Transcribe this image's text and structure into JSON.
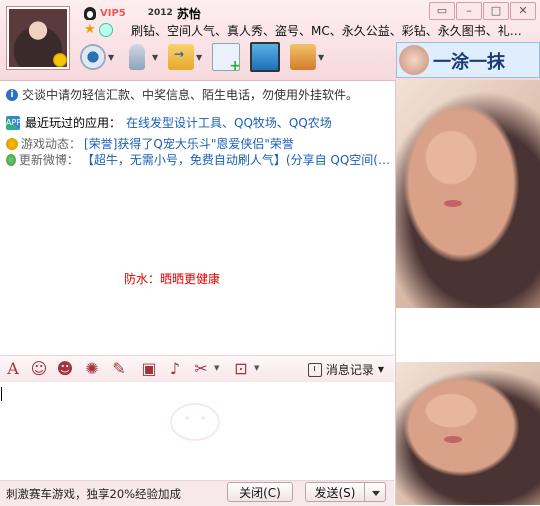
{
  "header": {
    "vip_badge": "VIP5",
    "year": "2012",
    "nickname": "苏怡",
    "signature": "刷钻、空间人气、真人秀、盗号、MC、永久公益、彩钻、永久图书、礼…"
  },
  "toolbar_icons": [
    "video-call-icon",
    "voice-call-icon",
    "send-file-icon",
    "create-group-icon",
    "remote-assist-icon",
    "app-icon"
  ],
  "brand": {
    "text": "一涂一抹"
  },
  "chat": {
    "safety_notice": "交谈中请勿轻信汇款、中奖信息、陌生电话，勿使用外挂软件。",
    "recent_apps_label": "最近玩过的应用：",
    "recent_apps_value": "在线发型设计工具、QQ牧场、QQ农场",
    "game_label": "游戏动态：",
    "game_value": "[荣誉]获得了Q宠大乐斗\"恩爱侠侣\"荣誉",
    "weibo_label": "更新微博：",
    "weibo_value": "【超牛，无需小号，免费自动刷人气】(分享自 QQ空间(…",
    "red_note": "防水：晒晒更健康"
  },
  "edit_toolbar": {
    "history_label": "消息记录"
  },
  "footer": {
    "promo": "刺激赛车游戏，独享20%经验加成",
    "close_label": "关闭(C)",
    "send_label": "发送(S)"
  },
  "colors": {
    "header_pink": "#f7d9dd",
    "link_blue": "#1a5fb4",
    "notice_red": "#dd0000"
  }
}
